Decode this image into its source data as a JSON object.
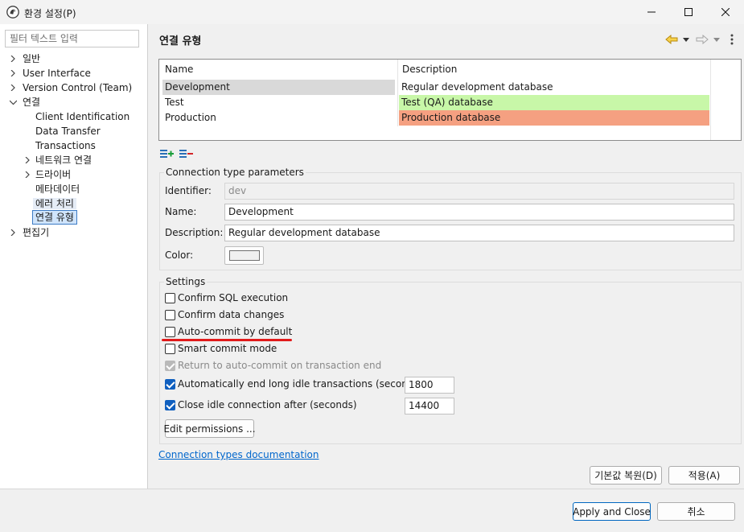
{
  "window": {
    "title": "환경 설정(P)",
    "colors": {
      "accent": "#0f5fbf",
      "test_row": "#c8f7a8",
      "production_row": "#f5a081",
      "selection_bg": "#cfe4fb",
      "underline": "#e11b1b"
    }
  },
  "sidebar": {
    "filter_placeholder": "필터 텍스트 입력",
    "items": [
      {
        "label": "일반",
        "expandable": true,
        "expanded": false
      },
      {
        "label": "User Interface",
        "expandable": true,
        "expanded": false
      },
      {
        "label": "Version Control (Team)",
        "expandable": true,
        "expanded": false
      },
      {
        "label": "연결",
        "expandable": true,
        "expanded": true
      },
      {
        "label": "Client Identification"
      },
      {
        "label": "Data Transfer"
      },
      {
        "label": "Transactions"
      },
      {
        "label": "네트워크 연결",
        "expandable": true,
        "expanded": false
      },
      {
        "label": "드라이버",
        "expandable": true,
        "expanded": false
      },
      {
        "label": "메타데이터"
      },
      {
        "label": "에러 처리",
        "highlighted": true
      },
      {
        "label": "연결 유형",
        "selected": true
      },
      {
        "label": "편집기",
        "expandable": true,
        "expanded": false
      }
    ]
  },
  "page": {
    "title": "연결 유형"
  },
  "types_table": {
    "headers": [
      "Name",
      "Description"
    ],
    "rows": [
      {
        "name": "Development",
        "description": "Regular development database",
        "color": "#ffffff",
        "selected": true
      },
      {
        "name": "Test",
        "description": "Test (QA) database",
        "color": "#c8f7a8"
      },
      {
        "name": "Production",
        "description": "Production database",
        "color": "#f5a081"
      }
    ]
  },
  "params": {
    "group_title": "Connection type parameters",
    "identifier_label": "Identifier:",
    "identifier_value": "dev",
    "name_label": "Name:",
    "name_value": "Development",
    "description_label": "Description:",
    "description_value": "Regular development database",
    "color_label": "Color:"
  },
  "settings": {
    "group_title": "Settings",
    "confirm_sql": "Confirm SQL execution",
    "confirm_data": "Confirm data changes",
    "auto_commit": "Auto-commit by default",
    "smart_commit": "Smart commit mode",
    "return_auto_commit": "Return to auto-commit on transaction end",
    "auto_end_idle": "Automatically end long idle transactions (seconds)",
    "auto_end_idle_value": "1800",
    "close_idle": "Close idle connection after (seconds)",
    "close_idle_value": "14400",
    "edit_permissions": "Edit permissions ..."
  },
  "doc_link": "Connection types documentation",
  "buttons": {
    "restore_defaults": "기본값 복원(D)",
    "apply": "적용(A)",
    "apply_close": "Apply and Close",
    "cancel": "취소"
  }
}
